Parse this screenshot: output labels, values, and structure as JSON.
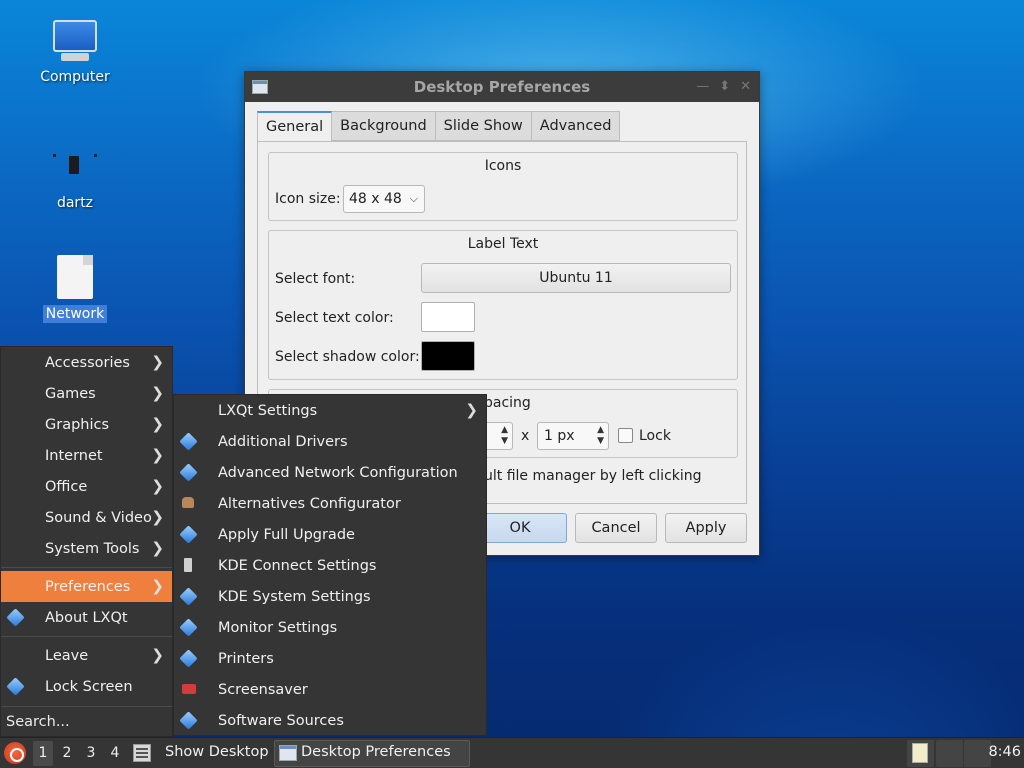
{
  "desktop": {
    "icons": [
      {
        "label": "Computer",
        "icon": "computer-icon"
      },
      {
        "label": "dartz",
        "icon": "usb-drive-icon"
      },
      {
        "label": "Network",
        "icon": "file-icon",
        "selected": true
      }
    ]
  },
  "dialog": {
    "title": "Desktop Preferences",
    "tabs": [
      "General",
      "Background",
      "Slide Show",
      "Advanced"
    ],
    "active_tab": "General",
    "icons_group": {
      "title": "Icons",
      "icon_size_label": "Icon size:",
      "icon_size_value": "48 x 48"
    },
    "label_text_group": {
      "title": "Label Text",
      "select_font_label": "Select font:",
      "font_value": "Ubuntu 11",
      "text_color_label": "Select text color:",
      "text_color": "#ffffff",
      "shadow_color_label": "Select shadow color:",
      "shadow_color": "#000000"
    },
    "spacing_group": {
      "title_partial": "pacing",
      "spin1_value": "",
      "x_label": "x",
      "spin2_value": "1 px",
      "lock_label": "Lock"
    },
    "file_manager_text_partial": "ult file manager by left clicking",
    "buttons": {
      "ok": "OK",
      "cancel": "Cancel",
      "apply": "Apply"
    }
  },
  "main_menu": {
    "items": [
      {
        "label": "Accessories",
        "submenu": true
      },
      {
        "label": "Games",
        "submenu": true
      },
      {
        "label": "Graphics",
        "submenu": true
      },
      {
        "label": "Internet",
        "submenu": true
      },
      {
        "label": "Office",
        "submenu": true
      },
      {
        "label": "Sound & Video",
        "submenu": true
      },
      {
        "label": "System Tools",
        "submenu": true
      },
      {
        "label": "Preferences",
        "submenu": true,
        "active": true
      },
      {
        "label": "About LXQt",
        "icon": "lxqt-icon"
      },
      {
        "label": "Leave",
        "submenu": true
      },
      {
        "label": "Lock Screen",
        "icon": "lxqt-icon"
      }
    ],
    "search_label": "Search...",
    "accent_color": "#ef7f3d"
  },
  "preferences_submenu": {
    "items": [
      {
        "label": "LXQt Settings",
        "submenu": true
      },
      {
        "label": "Additional Drivers",
        "icon": "driver-icon"
      },
      {
        "label": "Advanced Network Configuration",
        "icon": "network-config-icon"
      },
      {
        "label": "Alternatives Configurator",
        "icon": "cow-icon"
      },
      {
        "label": "Apply Full Upgrade",
        "icon": "upgrade-icon"
      },
      {
        "label": "KDE Connect Settings",
        "icon": "phone-icon"
      },
      {
        "label": "KDE System Settings",
        "icon": "settings-icon"
      },
      {
        "label": "Monitor Settings",
        "icon": "monitor-settings-icon"
      },
      {
        "label": "Printers",
        "icon": "printer-icon"
      },
      {
        "label": "Screensaver",
        "icon": "screensaver-icon"
      },
      {
        "label": "Software Sources",
        "icon": "software-sources-icon"
      }
    ]
  },
  "taskbar": {
    "workspaces": [
      "1",
      "2",
      "3",
      "4"
    ],
    "active_workspace": "1",
    "show_desktop_label": "Show Desktop",
    "task_label": "Desktop Preferences",
    "clock": "8:46"
  }
}
